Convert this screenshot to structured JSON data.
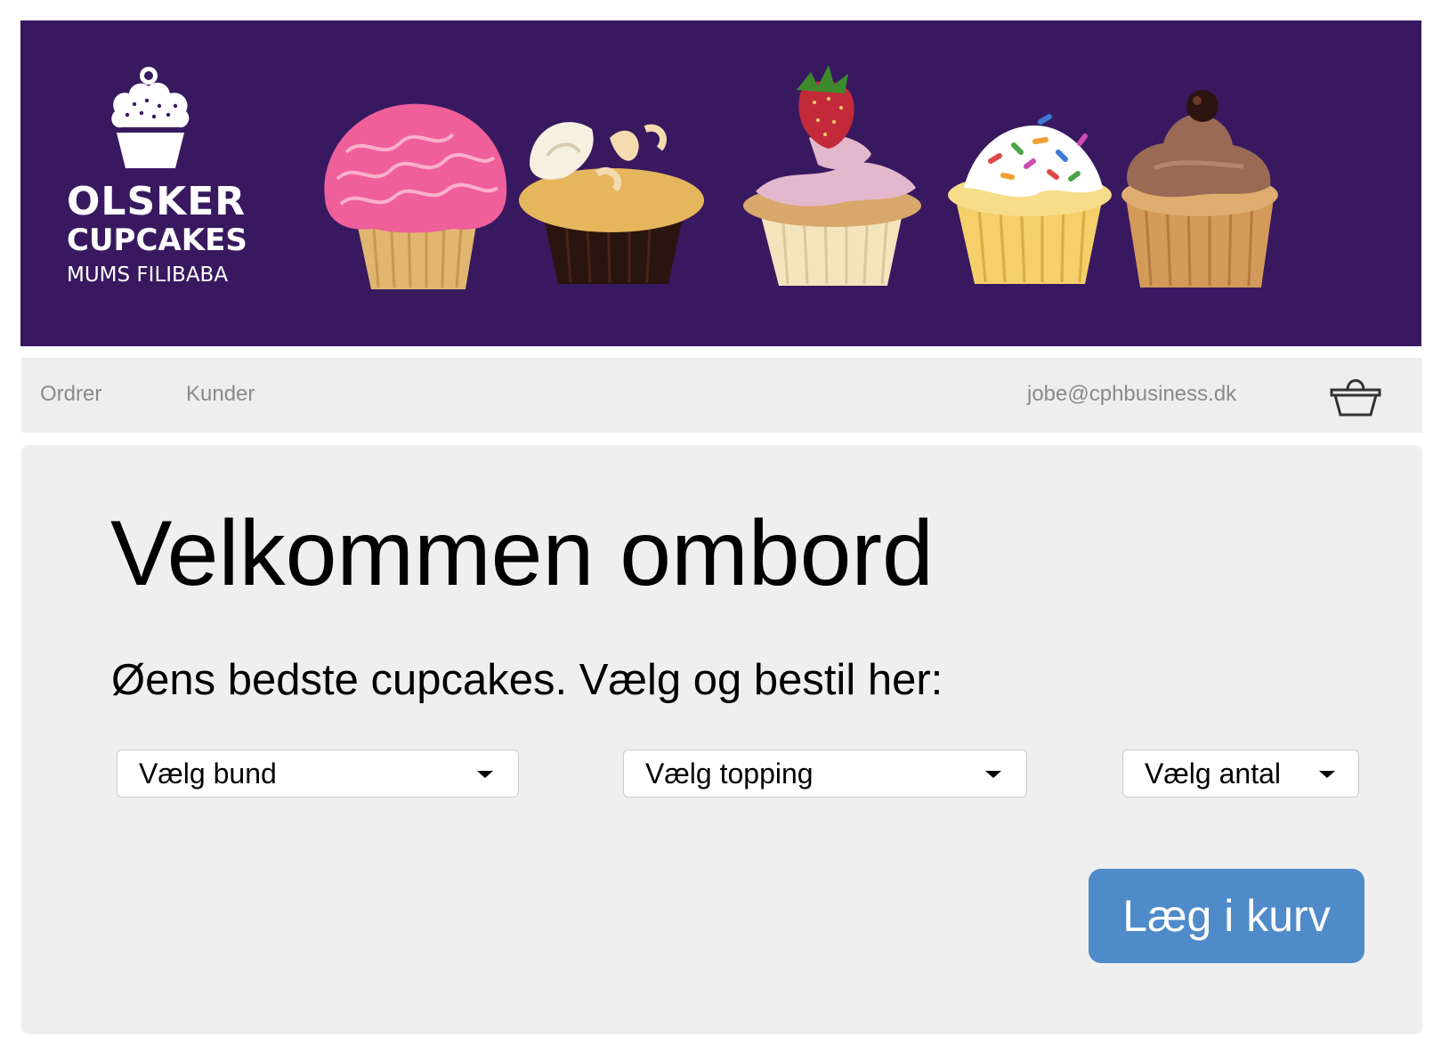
{
  "banner": {
    "background_color": "#381960",
    "logo": {
      "line1": "OLSKER",
      "line2": "CUPCAKES",
      "line3": "MUMS FILIBABA",
      "icon": "cupcake-icon"
    },
    "cupcakes": [
      {
        "name": "pink-frosting-cupcake"
      },
      {
        "name": "vanilla-chocolate-cupcake"
      },
      {
        "name": "strawberry-cupcake"
      },
      {
        "name": "sprinkles-cupcake"
      },
      {
        "name": "chocolate-frosting-cupcake"
      }
    ]
  },
  "nav": {
    "orders_label": "Ordrer",
    "customers_label": "Kunder",
    "user_email": "jobe@cphbusiness.dk",
    "basket_icon": "shopping-basket-icon"
  },
  "main": {
    "headline": "Velkommen ombord",
    "subline": "Øens bedste cupcakes. Vælg og bestil her:",
    "selects": {
      "bund": "Vælg bund",
      "topping": "Vælg topping",
      "antal": "Vælg antal"
    },
    "add_button_label": "Læg i kurv",
    "accent_color": "#4f8ac9"
  }
}
